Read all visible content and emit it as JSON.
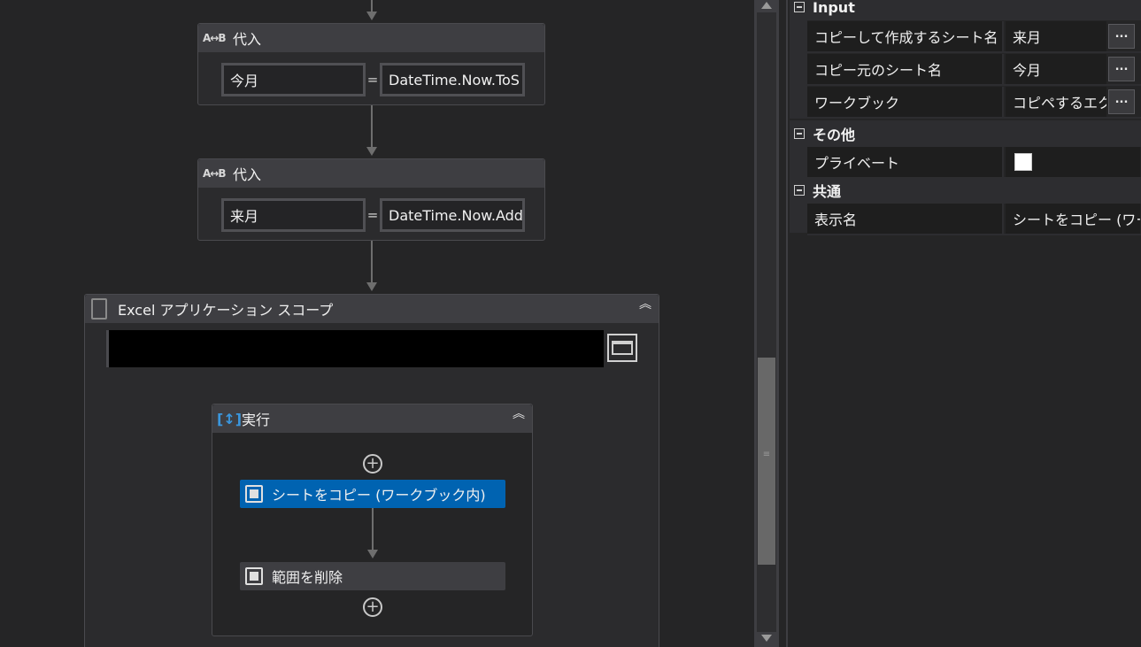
{
  "designer": {
    "assign1": {
      "title": "代入",
      "icon": "assign-ab-icon",
      "left_value": "今月",
      "equals": "=",
      "right_value": "DateTime.Now.ToS"
    },
    "assign2": {
      "title": "代入",
      "icon": "assign-ab-icon",
      "left_value": "来月",
      "equals": "=",
      "right_value": "DateTime.Now.Add"
    },
    "excel_scope": {
      "title": "Excel アプリケーション スコープ",
      "file_path": ""
    },
    "do_sequence": {
      "title": "実行",
      "activities": [
        {
          "label": "シートをコピー (ワークブック内)",
          "selected": true
        },
        {
          "label": "範囲を削除",
          "selected": false
        }
      ]
    },
    "colors": {
      "selected": "#0063b1",
      "header": "#3e3e42",
      "background": "#252526"
    }
  },
  "properties": {
    "categories": [
      {
        "title": "Input",
        "rows": [
          {
            "name": "コピーして作成するシート名",
            "value": "来月",
            "button": "..."
          },
          {
            "name": "コピー元のシート名",
            "value": "今月",
            "button": "..."
          },
          {
            "name": "ワークブック",
            "value": "コピペするエク",
            "button": "..."
          }
        ]
      },
      {
        "title": "その他",
        "rows": [
          {
            "name": "プライベート",
            "checked": false
          }
        ]
      },
      {
        "title": "共通",
        "rows": [
          {
            "name": "表示名",
            "value": "シートをコピー (ワークブ"
          }
        ]
      }
    ]
  }
}
